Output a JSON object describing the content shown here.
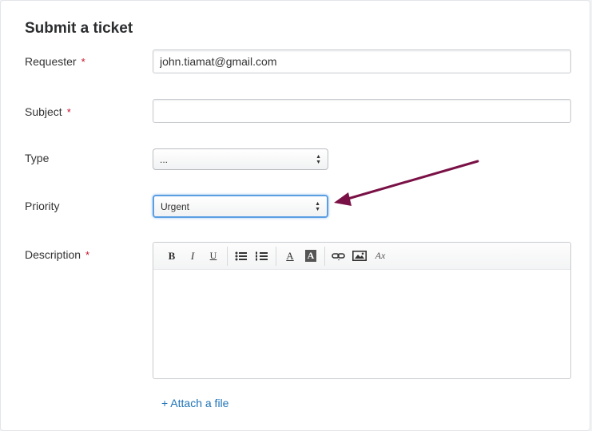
{
  "form": {
    "title": "Submit a ticket",
    "required_marker": "*",
    "requester": {
      "label": "Requester",
      "value": "john.tiamat@gmail.com"
    },
    "subject": {
      "label": "Subject",
      "value": ""
    },
    "type": {
      "label": "Type",
      "selected": "..."
    },
    "priority": {
      "label": "Priority",
      "selected": "Urgent"
    },
    "description": {
      "label": "Description",
      "toolbar": {
        "bold": "B",
        "italic": "I",
        "underline": "U",
        "text_color": "A",
        "bg_color": "A",
        "clear_format": "Ax"
      }
    },
    "attach_label": "+ Attach a file"
  },
  "colors": {
    "required": "#c8102e",
    "link": "#1f73b7",
    "focus": "#5b9fe3",
    "annotation_arrow": "#7a1146"
  }
}
